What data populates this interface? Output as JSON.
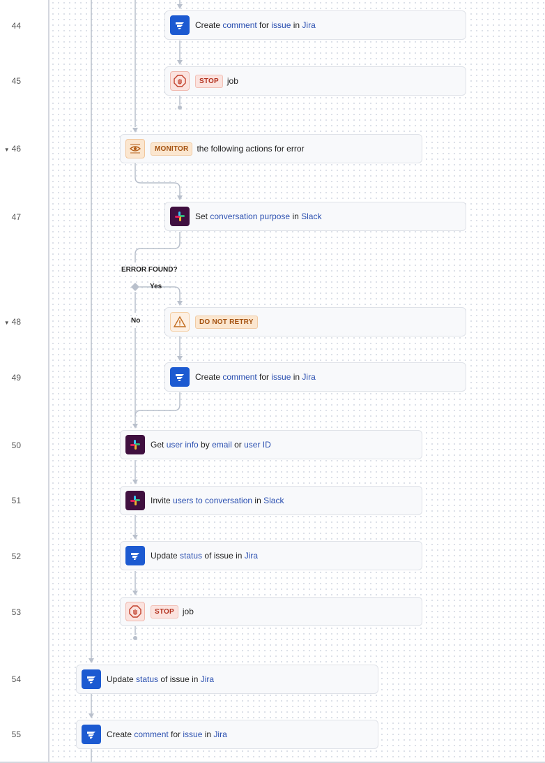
{
  "colors": {
    "jira": "#1c5ad1",
    "slack": "#3f0f3f",
    "link": "#2a4fb0",
    "stop": "#b3321f",
    "monitor": "#a45210",
    "connector": "#b9c0cc"
  },
  "lines": [
    {
      "num": "44",
      "caret": false
    },
    {
      "num": "45",
      "caret": false
    },
    {
      "num": "46",
      "caret": true
    },
    {
      "num": "47",
      "caret": false
    },
    {
      "num": "48",
      "caret": true
    },
    {
      "num": "49",
      "caret": false
    },
    {
      "num": "50",
      "caret": false
    },
    {
      "num": "51",
      "caret": false
    },
    {
      "num": "52",
      "caret": false
    },
    {
      "num": "53",
      "caret": false
    },
    {
      "num": "54",
      "caret": false
    },
    {
      "num": "55",
      "caret": false
    }
  ],
  "steps": {
    "s44": {
      "icon": "jira-icon",
      "parts": [
        "Create ",
        "comment",
        " for ",
        "issue",
        " in ",
        "Jira"
      ]
    },
    "s45": {
      "icon": "stop-hand-icon",
      "tag": "STOP",
      "text": "job"
    },
    "s46": {
      "icon": "eye-icon",
      "tag": "MONITOR",
      "text": "the following actions for error"
    },
    "s47": {
      "icon": "slack-icon",
      "parts": [
        "Set ",
        "conversation purpose",
        " in ",
        "Slack"
      ]
    },
    "s48": {
      "icon": "warning-icon",
      "tag": "DO NOT RETRY"
    },
    "s49": {
      "icon": "jira-icon",
      "parts": [
        "Create ",
        "comment",
        " for ",
        "issue",
        " in ",
        "Jira"
      ]
    },
    "s50": {
      "icon": "slack-icon",
      "parts": [
        "Get ",
        "user info",
        " by ",
        "email",
        " or ",
        "user ID"
      ]
    },
    "s51": {
      "icon": "slack-icon",
      "parts": [
        "Invite ",
        "users to conversation",
        " in ",
        "Slack"
      ]
    },
    "s52": {
      "icon": "jira-icon",
      "parts": [
        "Update ",
        "status",
        " of issue in ",
        "Jira"
      ]
    },
    "s53": {
      "icon": "stop-hand-icon",
      "tag": "STOP",
      "text": "job"
    },
    "s54": {
      "icon": "jira-icon",
      "parts": [
        "Update ",
        "status",
        " of issue in ",
        "Jira"
      ]
    },
    "s55": {
      "icon": "jira-icon",
      "parts": [
        "Create ",
        "comment",
        " for ",
        "issue",
        " in ",
        "Jira"
      ]
    }
  },
  "branch": {
    "title": "ERROR FOUND?",
    "yes": "Yes",
    "no": "No"
  }
}
